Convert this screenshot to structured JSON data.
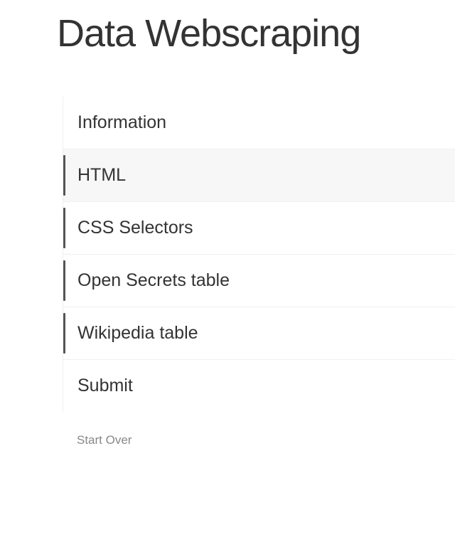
{
  "title": "Data Webscraping",
  "nav": {
    "items": [
      {
        "label": "Information",
        "indicator": false,
        "active": false
      },
      {
        "label": "HTML",
        "indicator": true,
        "active": true
      },
      {
        "label": "CSS Selectors",
        "indicator": true,
        "active": false
      },
      {
        "label": "Open Secrets table",
        "indicator": true,
        "active": false
      },
      {
        "label": "Wikipedia table",
        "indicator": true,
        "active": false
      },
      {
        "label": "Submit",
        "indicator": false,
        "active": false
      }
    ]
  },
  "footer": {
    "start_over": "Start Over"
  }
}
